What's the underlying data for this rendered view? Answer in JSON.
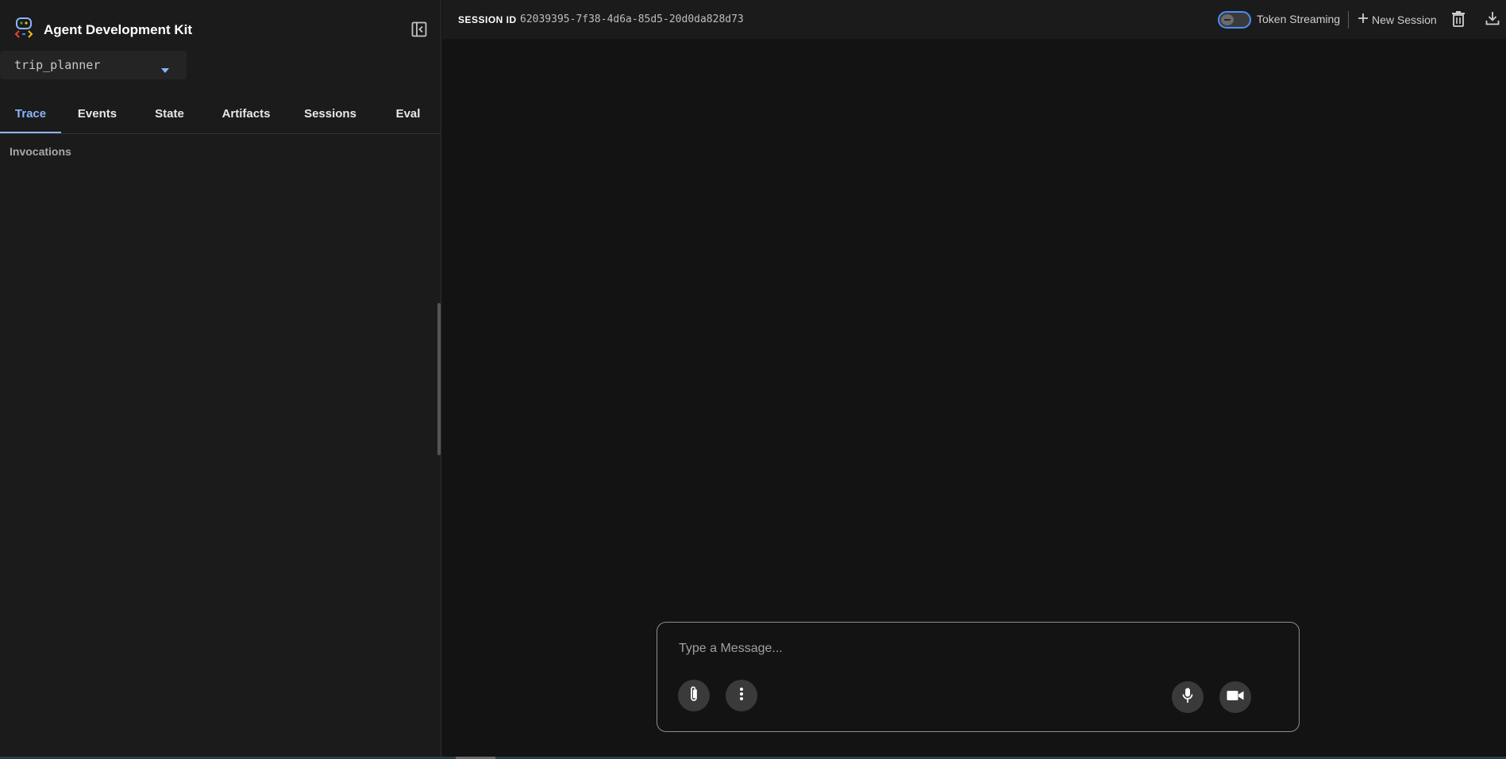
{
  "app": {
    "title": "Agent Development Kit",
    "icon": "adk-logo-icon"
  },
  "agent_selector": {
    "value": "trip_planner",
    "icon": "caret-down-icon"
  },
  "tabs": [
    {
      "label": "Trace",
      "active": true
    },
    {
      "label": "Events",
      "active": false
    },
    {
      "label": "State",
      "active": false
    },
    {
      "label": "Artifacts",
      "active": false
    },
    {
      "label": "Sessions",
      "active": false
    },
    {
      "label": "Eval",
      "active": false
    }
  ],
  "trace_panel": {
    "section_label": "Invocations"
  },
  "header": {
    "session_label": "SESSION ID",
    "session_id": "62039395-7f38-4d6a-85d5-20d0da828d73",
    "token_streaming": {
      "label": "Token Streaming",
      "enabled": false
    },
    "new_session_label": "New Session",
    "icons": [
      "add-icon",
      "delete-icon",
      "download-icon"
    ]
  },
  "composer": {
    "placeholder": "Type a Message...",
    "value": "",
    "icons": [
      "attach-icon",
      "more-vert-icon",
      "mic-icon",
      "videocam-icon"
    ]
  },
  "colors": {
    "accent": "#8ab4f8",
    "toggle_border": "#4c8df6",
    "sidebar_bg": "#1b1b1b",
    "main_bg": "#131314"
  }
}
